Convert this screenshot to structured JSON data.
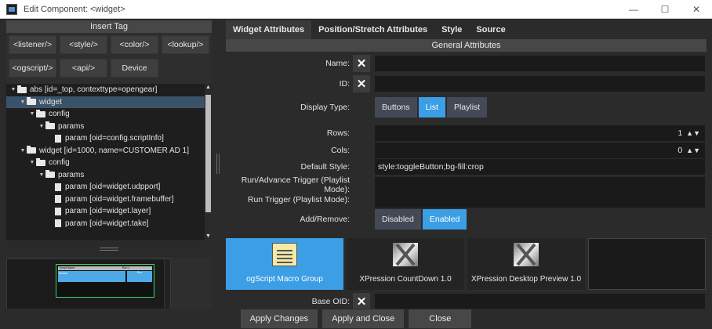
{
  "window": {
    "title": "Edit Component: <widget>",
    "controls": {
      "minimize": "—",
      "maximize": "☐",
      "close": "✕"
    }
  },
  "insert_tag": {
    "header": "Insert Tag",
    "buttons": [
      "<listener/>",
      "<style/>",
      "<color/>",
      "<lookup/>",
      "<ogscript/>",
      "<api/>",
      "Device"
    ]
  },
  "tree": {
    "rows": [
      {
        "indent": 0,
        "caret": true,
        "icon": "folder",
        "label": "abs [id=_top, contexttype=opengear]",
        "selected": false
      },
      {
        "indent": 1,
        "caret": true,
        "icon": "folder",
        "label": "widget",
        "selected": true
      },
      {
        "indent": 2,
        "caret": true,
        "icon": "folder",
        "label": "config",
        "selected": false
      },
      {
        "indent": 3,
        "caret": true,
        "icon": "folder",
        "label": "params",
        "selected": false
      },
      {
        "indent": 4,
        "caret": false,
        "icon": "doc",
        "label": "param [oid=config.scriptInfo]",
        "selected": false
      },
      {
        "indent": 1,
        "caret": true,
        "icon": "folder",
        "label": "widget [id=1000, name=CUSTOMER AD 1]",
        "selected": false
      },
      {
        "indent": 2,
        "caret": true,
        "icon": "folder",
        "label": "config",
        "selected": false
      },
      {
        "indent": 3,
        "caret": true,
        "icon": "folder",
        "label": "params",
        "selected": false
      },
      {
        "indent": 4,
        "caret": false,
        "icon": "doc",
        "label": "param [oid=widget.udpport]",
        "selected": false
      },
      {
        "indent": 4,
        "caret": false,
        "icon": "doc",
        "label": "param [oid=widget.framebuffer]",
        "selected": false
      },
      {
        "indent": 4,
        "caret": false,
        "icon": "doc",
        "label": "param [oid=widget.layer]",
        "selected": false
      },
      {
        "indent": 4,
        "caret": false,
        "icon": "doc",
        "label": "param [oid=widget.take]",
        "selected": false
      }
    ]
  },
  "preview": {
    "headers": [
      "Script Name",
      "Run 1"
    ],
    "row": [
      "Default",
      "Run"
    ]
  },
  "tabs": [
    "Widget Attributes",
    "Position/Stretch Attributes",
    "Style",
    "Source"
  ],
  "general": {
    "header": "General Attributes",
    "name_label": "Name:",
    "name_value": "",
    "id_label": "ID:",
    "id_value": "",
    "display_type_label": "Display Type:",
    "display_type_options": [
      "Buttons",
      "List",
      "Playlist"
    ],
    "display_type_selected": "List",
    "rows_label": "Rows:",
    "rows_value": "1",
    "cols_label": "Cols:",
    "cols_value": "0",
    "default_style_label": "Default Style:",
    "default_style_value": "style:toggleButton;bg-fill:crop",
    "run_advance_label": "Run/Advance Trigger (Playlist Mode):",
    "run_advance_value": "",
    "run_trigger_label": "Run Trigger (Playlist Mode):",
    "run_trigger_value": "",
    "add_remove_label": "Add/Remove:",
    "add_remove_options": [
      "Disabled",
      "Enabled"
    ],
    "add_remove_selected": "Enabled",
    "base_oid_label": "Base OID:",
    "base_oid_value": "",
    "clear_symbol": "✕"
  },
  "cards": [
    {
      "label": "ogScript Macro Group",
      "icon": "script-note-icon",
      "selected": true
    },
    {
      "label": "XPression CountDown 1.0",
      "icon": "xpression-icon",
      "selected": false
    },
    {
      "label": "XPression Desktop Preview 1.0",
      "icon": "xpression-icon",
      "selected": false
    }
  ],
  "footer": {
    "apply": "Apply Changes",
    "apply_close": "Apply and Close",
    "close": "Close"
  },
  "colors": {
    "accent": "#3c9ee4",
    "selection": "#3b5368",
    "background": "#2b2b2b",
    "preview_border": "#3ad26a"
  }
}
